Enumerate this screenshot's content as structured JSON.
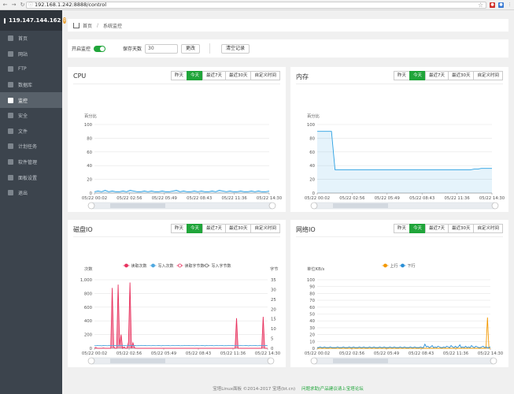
{
  "browser": {
    "url": "192.168.1.242:8888/control"
  },
  "sidebar": {
    "ip": "119.147.144.162",
    "badge": "0",
    "items": [
      {
        "label": "首页",
        "icon": "home-icon"
      },
      {
        "label": "网站",
        "icon": "globe-icon"
      },
      {
        "label": "FTP",
        "icon": "ftp-icon"
      },
      {
        "label": "数据库",
        "icon": "database-icon"
      },
      {
        "label": "监控",
        "icon": "chart-icon",
        "active": true
      },
      {
        "label": "安全",
        "icon": "shield-icon"
      },
      {
        "label": "文件",
        "icon": "folder-icon"
      },
      {
        "label": "计划任务",
        "icon": "clock-icon"
      },
      {
        "label": "软件管理",
        "icon": "app-icon"
      },
      {
        "label": "面板设置",
        "icon": "gear-icon"
      },
      {
        "label": "退出",
        "icon": "logout-icon"
      }
    ]
  },
  "breadcrumb": {
    "home": "首页",
    "current": "系统监控"
  },
  "toolbar": {
    "monitor_label": "开启监控",
    "retention_label": "保存天数",
    "retention_value": "30",
    "change_button": "更改",
    "clear_button": "清空记录"
  },
  "tabs": [
    "昨天",
    "今天",
    "最近7天",
    "最近30天",
    "自定义时间"
  ],
  "active_tab": 1,
  "colors": {
    "accent": "#20a53a",
    "line": "#2aa0e2",
    "read": "#e8335f",
    "write": "#4fa8e0",
    "up": "#f39800",
    "down": "#2a8fd6"
  },
  "footer": {
    "copyright": "宝塔Linux面板 ©2014-2017 宝塔(bt.cn)",
    "link": "问题求助|产品建议请上宝塔论坛"
  },
  "panels": {
    "cpu": {
      "title": "CPU"
    },
    "mem": {
      "title": "内存"
    },
    "disk": {
      "title": "磁盘IO"
    },
    "net": {
      "title": "网络IO"
    }
  },
  "chart_data": [
    {
      "id": "cpu",
      "type": "area",
      "ylabel": "百分比",
      "ylim": [
        0,
        100
      ],
      "yticks": [
        0,
        20,
        40,
        60,
        80,
        100
      ],
      "xticks": [
        "05/22 00:02",
        "05/22 02:56",
        "05/22 05:49",
        "05/22 08:43",
        "05/22 11:36",
        "05/22 14:30"
      ],
      "series": [
        {
          "values": [
            2,
            3,
            2,
            4,
            2,
            3,
            2,
            2,
            3,
            2,
            4,
            3,
            2,
            2,
            3,
            2,
            3,
            2,
            2,
            3,
            2,
            2,
            3,
            4,
            2,
            3,
            2,
            2,
            3,
            2,
            3,
            2,
            2,
            3,
            2,
            4,
            3,
            2,
            3,
            2,
            2,
            3,
            2,
            2,
            3,
            2,
            3,
            2,
            2,
            3
          ]
        }
      ]
    },
    {
      "id": "mem",
      "type": "area",
      "ylabel": "百分比",
      "ylim": [
        0,
        100
      ],
      "yticks": [
        0,
        20,
        40,
        60,
        80,
        100
      ],
      "xticks": [
        "05/22 00:02",
        "05/22 02:56",
        "05/22 05:49",
        "05/22 08:43",
        "05/22 11:36",
        "05/22 14:30"
      ],
      "series": [
        {
          "values": [
            90,
            90,
            90,
            90,
            90,
            34,
            34,
            34,
            34,
            34,
            34,
            34,
            34,
            34,
            34,
            34,
            34,
            34,
            34,
            34,
            34,
            34,
            34,
            34,
            34,
            34,
            34,
            34,
            34,
            34,
            34,
            34,
            34,
            34,
            34,
            34,
            34,
            34,
            34,
            34,
            34,
            34,
            34,
            34,
            35,
            35,
            36,
            36,
            36,
            36
          ]
        }
      ]
    },
    {
      "id": "disk",
      "type": "line",
      "ylabel": "次数",
      "ylabel_right": "字节",
      "ylim": [
        0,
        1000
      ],
      "yticks": [
        0,
        200,
        400,
        600,
        800,
        1000
      ],
      "yticks_display": [
        "0",
        "200",
        "400",
        "600",
        "800",
        "1,000"
      ],
      "yticks_right": [
        0,
        5,
        10,
        15,
        20,
        25,
        30,
        35
      ],
      "xticks": [
        "05/22 00:02",
        "05/22 02:56",
        "05/22 05:49",
        "05/22 08:43",
        "05/22 11:36",
        "05/22 14:30"
      ],
      "legend": [
        "读取次数",
        "写入次数",
        "读取字节数",
        "写入字节数"
      ],
      "series": [
        {
          "name": "读取次数",
          "values": [
            5,
            10,
            0,
            0,
            0,
            0,
            5,
            0,
            0,
            0,
            0,
            0,
            880,
            20,
            0,
            0,
            930,
            50,
            200,
            0,
            20,
            0,
            0,
            90,
            960,
            0,
            80,
            10,
            0,
            0,
            0,
            0,
            0,
            0,
            0,
            0,
            0,
            0,
            0,
            0,
            0,
            0,
            0,
            0,
            0,
            0,
            0,
            0,
            0,
            0,
            0,
            0,
            0,
            0,
            0,
            0,
            0,
            0,
            0,
            0,
            0,
            0,
            0,
            0,
            0,
            0,
            0,
            0,
            0,
            0,
            0,
            0,
            0,
            0,
            0,
            0,
            0,
            0,
            0,
            0,
            0,
            0,
            0,
            0,
            0,
            0,
            0,
            0,
            0,
            0,
            0,
            0,
            0,
            0,
            0,
            0,
            440,
            0,
            0,
            0,
            0,
            0,
            0,
            0,
            0,
            0,
            0,
            0,
            0,
            0,
            0,
            0,
            0,
            0,
            460,
            0,
            0,
            0
          ]
        },
        {
          "name": "写入次数",
          "values": [
            40,
            35,
            42,
            38,
            40,
            36,
            41,
            39,
            40,
            37,
            42,
            40,
            38,
            39,
            41,
            40,
            36,
            42,
            38,
            40,
            39,
            41,
            37,
            40,
            42,
            38,
            40,
            39,
            41,
            37,
            40,
            38,
            42,
            39,
            40,
            41,
            38,
            40,
            39,
            37,
            42,
            40,
            38,
            39,
            41,
            40,
            36,
            42,
            38,
            40,
            39,
            41,
            37,
            40,
            42,
            38,
            40,
            39,
            41,
            37,
            40,
            38,
            42,
            39,
            40,
            41,
            38,
            40,
            39,
            37,
            42,
            40,
            38,
            39,
            41,
            40,
            36,
            42,
            38,
            40,
            39,
            41,
            37,
            40,
            42,
            38,
            40,
            39,
            41,
            37,
            40,
            38,
            42,
            39,
            40,
            41,
            38,
            40,
            39,
            37,
            42,
            40,
            38,
            39,
            41,
            40,
            36,
            42,
            38,
            40,
            39,
            41,
            37,
            40,
            42,
            38,
            40,
            39,
            41,
            37
          ]
        }
      ]
    },
    {
      "id": "net",
      "type": "line",
      "ylabel": "单位KB/s",
      "ylim": [
        0,
        100
      ],
      "yticks": [
        0,
        10,
        20,
        30,
        40,
        50,
        60,
        70,
        80,
        90,
        100
      ],
      "xticks": [
        "05/22 00:02",
        "05/22 02:56",
        "05/22 05:49",
        "05/22 08:43",
        "05/22 11:36",
        "05/22 14:30"
      ],
      "legend": [
        "上行",
        "下行"
      ],
      "series": [
        {
          "name": "上行",
          "values": [
            0,
            0,
            0,
            0,
            0,
            0,
            0,
            0,
            0,
            0,
            0,
            0,
            0,
            0,
            0,
            0,
            0,
            0,
            0,
            0,
            0,
            0,
            0,
            0,
            0,
            0,
            0,
            0,
            0,
            0,
            0,
            0,
            0,
            0,
            0,
            0,
            0,
            0,
            0,
            0,
            0,
            0,
            0,
            0,
            0,
            0,
            0,
            0,
            0,
            0,
            0,
            0,
            0,
            0,
            0,
            0,
            0,
            0,
            0,
            0,
            0,
            0,
            0,
            0,
            0,
            0,
            0,
            0,
            0,
            0,
            0,
            0,
            0,
            0,
            0,
            0,
            0,
            0,
            0,
            0,
            0,
            0,
            0,
            0,
            0,
            0,
            0,
            0,
            0,
            0,
            0,
            0,
            0,
            0,
            0,
            0,
            0,
            0,
            0,
            0,
            0,
            0,
            0,
            0,
            0,
            0,
            0,
            0,
            0,
            0,
            0,
            0,
            0,
            0,
            0,
            0,
            0,
            45,
            0,
            0
          ]
        },
        {
          "name": "下行",
          "values": [
            1,
            1,
            2,
            1,
            1,
            2,
            1,
            1,
            1,
            2,
            1,
            1,
            1,
            1,
            2,
            1,
            1,
            1,
            2,
            1,
            1,
            1,
            2,
            1,
            1,
            2,
            1,
            1,
            1,
            2,
            1,
            1,
            2,
            1,
            1,
            1,
            2,
            1,
            1,
            2,
            1,
            1,
            1,
            2,
            1,
            1,
            2,
            1,
            1,
            1,
            2,
            1,
            1,
            2,
            1,
            1,
            1,
            2,
            1,
            1,
            2,
            1,
            1,
            1,
            2,
            1,
            1,
            2,
            1,
            1,
            1,
            2,
            1,
            1,
            6,
            2,
            3,
            1,
            2,
            4,
            1,
            2,
            1,
            3,
            2,
            1,
            1,
            2,
            1,
            3,
            2,
            1,
            4,
            2,
            1,
            3,
            1,
            2,
            5,
            1,
            2,
            1,
            3,
            1,
            2,
            1,
            4,
            2,
            1,
            3,
            2,
            1,
            1,
            2,
            3,
            1,
            2,
            1,
            1,
            2
          ]
        }
      ]
    }
  ]
}
